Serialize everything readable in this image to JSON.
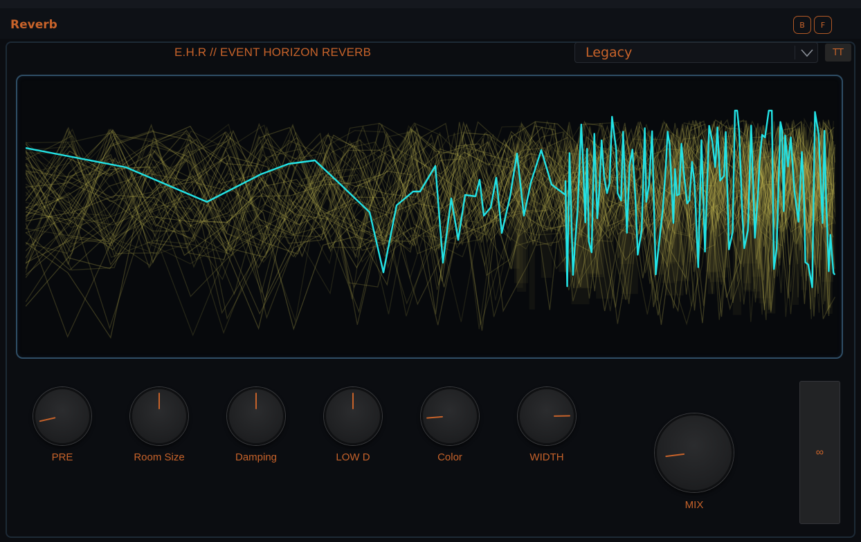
{
  "header": {
    "title": "Reverb",
    "btn_b": "B",
    "btn_f": "F"
  },
  "plugin": {
    "name": "E.H.R  //  EVENT HORIZON REVERB"
  },
  "preset": {
    "selected": "Legacy",
    "tt_label": "TT"
  },
  "knobs": [
    {
      "id": "pre",
      "label": "PRE",
      "value": 0.12
    },
    {
      "id": "room-size",
      "label": "Room Size",
      "value": 0.5
    },
    {
      "id": "damping",
      "label": "Damping",
      "value": 0.5
    },
    {
      "id": "low-d",
      "label": "LOW D",
      "value": 0.5
    },
    {
      "id": "color",
      "label": "Color",
      "value": 0.15
    },
    {
      "id": "width",
      "label": "WIDTH",
      "value": 0.83
    }
  ],
  "mix": {
    "label": "MIX",
    "value": 0.14
  },
  "freeze": {
    "label": "∞"
  },
  "colors": {
    "accent": "#c8632a",
    "trace": "#22e3e6",
    "history": "#c9bf55",
    "display_border": "#2f4e66"
  },
  "icons": {
    "preset_dropdown": "chevron-down-icon"
  }
}
